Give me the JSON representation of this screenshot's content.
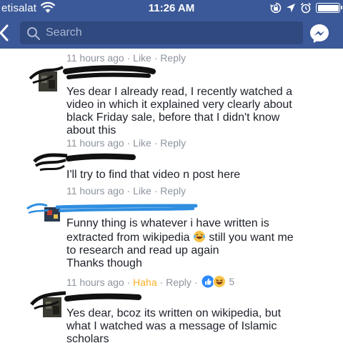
{
  "status_bar": {
    "carrier": "etisalat",
    "time": "11:26 AM",
    "icons": [
      "wifi-icon",
      "screen-lock-icon",
      "location-icon",
      "alarm-icon",
      "battery-icon"
    ]
  },
  "nav": {
    "search_placeholder": "Search",
    "icons": [
      "back-arrow-icon",
      "search-icon",
      "messenger-icon"
    ]
  },
  "colors": {
    "header": "#3b5998",
    "meta_text": "#8d949e",
    "haha": "#f7b125",
    "like_blue": "#2d88ff"
  },
  "comments": [
    {
      "meta": {
        "time": "11 hours ago",
        "like": "Like",
        "reply": "Reply"
      }
    },
    {
      "lines": [
        "Yes dear I already read, I recently watched a",
        "video in which it explained very clearly about",
        "black Friday sale, before that I didn't know",
        "about this"
      ],
      "meta": {
        "time": "11 hours ago",
        "like": "Like",
        "reply": "Reply"
      }
    },
    {
      "lines": [
        "I'll try to find that video n post here"
      ],
      "meta": {
        "time": "11 hours ago",
        "like": "Like",
        "reply": "Reply"
      }
    },
    {
      "lines": [
        "Funny thing is whatever i have written is",
        "extracted from wikipedia",
        "still you want me",
        "to research and read up again",
        "Thanks though"
      ],
      "meta": {
        "time": "11 hours ago",
        "reaction": "Haha",
        "reply": "Reply",
        "reaction_count": "5"
      }
    },
    {
      "lines": [
        "Yes dear, bcoz its written on wikipedia, but",
        "what I watched was a message of Islamic",
        "scholars"
      ]
    }
  ]
}
